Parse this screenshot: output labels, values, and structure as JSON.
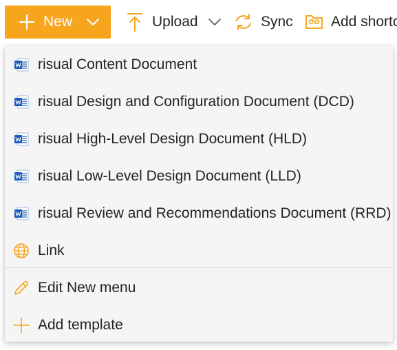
{
  "toolbar": {
    "new_label": "New",
    "upload_label": "Upload",
    "sync_label": "Sync",
    "add_shortcut_label": "Add shortcut"
  },
  "new_menu": {
    "items": [
      {
        "label": "risual Content Document",
        "icon": "word-icon"
      },
      {
        "label": "risual Design and Configuration Document (DCD)",
        "icon": "word-icon"
      },
      {
        "label": "risual High-Level Design Document (HLD)",
        "icon": "word-icon"
      },
      {
        "label": "risual Low-Level Design Document (LLD)",
        "icon": "word-icon"
      },
      {
        "label": "risual Review and Recommendations Document (RRD)",
        "icon": "word-icon"
      },
      {
        "label": "Link",
        "icon": "globe-icon"
      }
    ],
    "footer_items": [
      {
        "label": "Edit New menu",
        "icon": "pencil-icon"
      },
      {
        "label": "Add template",
        "icon": "plus-icon"
      }
    ]
  },
  "colors": {
    "accent": "#f7a51c",
    "word_blue": "#185abd",
    "menu_bg": "#f5f5f5"
  }
}
